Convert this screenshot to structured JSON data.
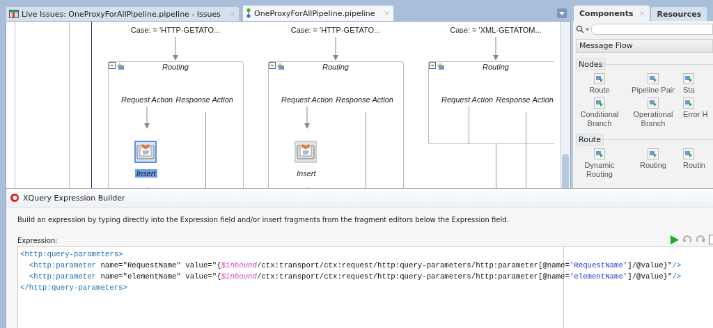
{
  "tabs": [
    {
      "label": "Live Issues: OneProxyForAllPipeline.pipeline - Issues",
      "selected": false,
      "kind": "issues"
    },
    {
      "label": "OneProxyForAllPipeline.pipeline",
      "selected": true,
      "kind": "pipeline"
    }
  ],
  "canvas": {
    "branches": [
      {
        "case": "Case:  = 'HTTP-GETATO...",
        "title": "Routing",
        "request_label": "Request Action",
        "response_label": "Response Action",
        "action": {
          "label": "Insert",
          "selected": true
        }
      },
      {
        "case": "Case:  = 'HTTP-GETATO...",
        "title": "Routing",
        "request_label": "Request Action",
        "response_label": "Response Action",
        "action": {
          "label": "Insert",
          "selected": false
        }
      },
      {
        "case": "Case:  = 'XML-GETATOM...",
        "title": "Routing",
        "request_label": "Request Action",
        "response_label": "Response Action"
      }
    ]
  },
  "palette": {
    "tabs": [
      {
        "label": "Components",
        "selected": true
      },
      {
        "label": "Resources",
        "selected": false
      }
    ],
    "category": "Message Flow",
    "sections": [
      {
        "title": "Nodes",
        "items": [
          "Route",
          "Pipeline Pair",
          "Sta",
          "Conditional Branch",
          "Operational Branch",
          "Error H"
        ]
      },
      {
        "title": "Route",
        "items": [
          "Dynamic Routing",
          "Routing",
          "Routin"
        ]
      }
    ]
  },
  "dialog": {
    "title": "XQuery Expression Builder",
    "instructions": "Build an expression by typing directly into the Expression field and/or insert fragments from the fragment editors below the Expression field.",
    "expression_label": "Expression:",
    "code_lines": [
      [
        {
          "kind": "tag",
          "text": "<http:query-parameters>"
        }
      ],
      [
        {
          "kind": "tag",
          "text": "  <http:parameter"
        },
        {
          "kind": "text",
          "text": " name=\"RequestName\" value=\"{"
        },
        {
          "kind": "var",
          "text": "$inbound"
        },
        {
          "kind": "text",
          "text": "/ctx:transport/ctx:request/http:query-parameters/http:parameter[@name="
        },
        {
          "kind": "literal",
          "text": "'RequestName'"
        },
        {
          "kind": "text",
          "text": "]/@value}\""
        },
        {
          "kind": "tag",
          "text": "/>"
        }
      ],
      [
        {
          "kind": "tag",
          "text": "  <http:parameter"
        },
        {
          "kind": "text",
          "text": " name=\"elementName\" value=\"{"
        },
        {
          "kind": "var",
          "text": "$inbound"
        },
        {
          "kind": "text",
          "text": "/ctx:transport/ctx:request/http:query-parameters/http:parameter[@name="
        },
        {
          "kind": "literal",
          "text": "'elementName'"
        },
        {
          "kind": "text",
          "text": "]/@value}\""
        },
        {
          "kind": "tag",
          "text": "/>"
        }
      ],
      [
        {
          "kind": "tag",
          "text": "</http:query-parameters>"
        }
      ]
    ]
  }
}
